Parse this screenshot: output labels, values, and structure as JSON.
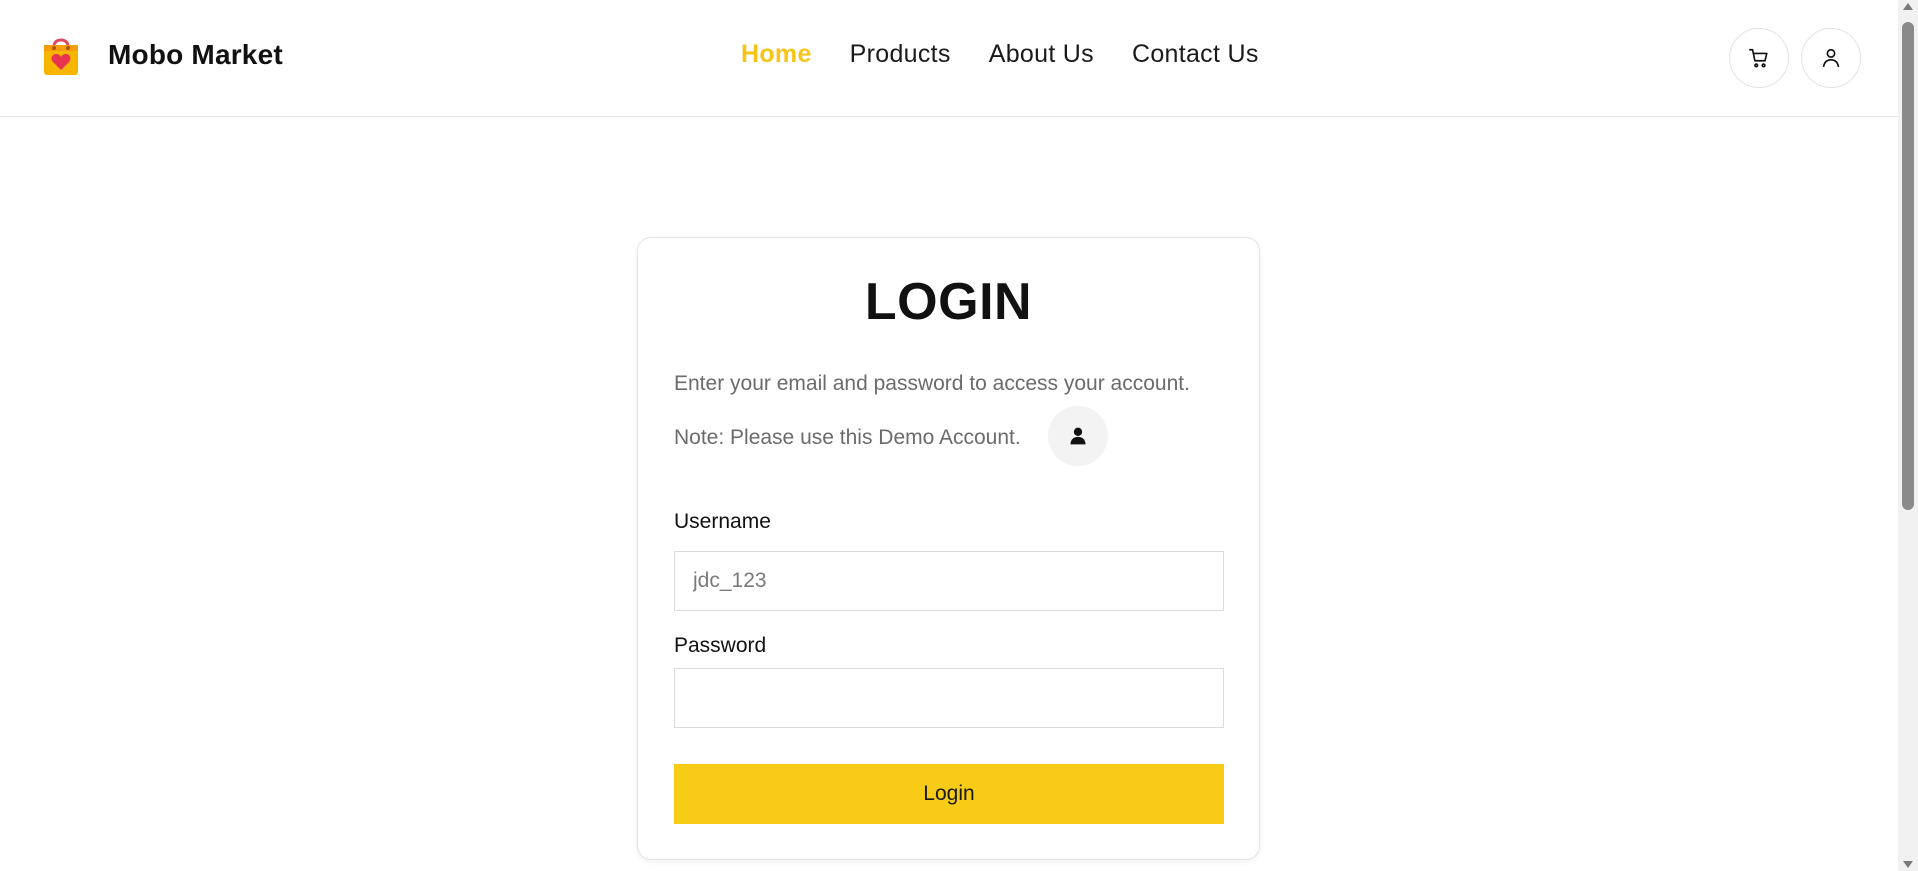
{
  "header": {
    "brand_name": "Mobo Market",
    "nav": [
      {
        "label": "Home",
        "active": true
      },
      {
        "label": "Products",
        "active": false
      },
      {
        "label": "About Us",
        "active": false
      },
      {
        "label": "Contact Us",
        "active": false
      }
    ],
    "icons": {
      "logo": "shopping-bag-heart-icon",
      "cart": "cart-icon",
      "user": "user-outline-icon"
    }
  },
  "login": {
    "title": "LOGIN",
    "subtitle": "Enter your email and password to access your account.",
    "note": "Note: Please use this Demo Account.",
    "demo_icon": "user-filled-icon",
    "username_label": "Username",
    "username_placeholder": "jdc_123",
    "username_value": "",
    "password_label": "Password",
    "password_value": "",
    "button_label": "Login"
  },
  "colors": {
    "accent": "#f8cb17",
    "active_nav": "#f5c518",
    "muted_text": "#6b6b6b"
  }
}
